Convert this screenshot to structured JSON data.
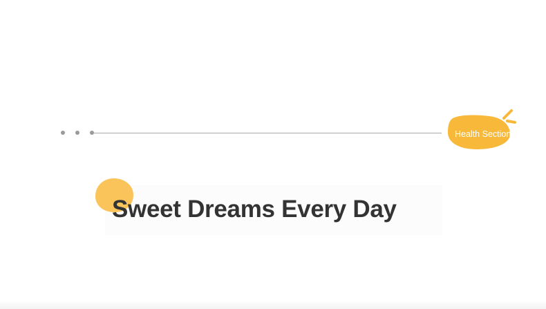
{
  "section": {
    "label": "Health Section"
  },
  "title": {
    "text": "Sweet Dreams Every Day"
  },
  "colors": {
    "accent": "#f8b93a",
    "accent_light": "#fbc45b",
    "title_text": "#333333",
    "line": "#a8a8a8",
    "dots": "#9a9a9a"
  },
  "icons": {
    "badge_rays": "sparkle-rays-icon"
  }
}
